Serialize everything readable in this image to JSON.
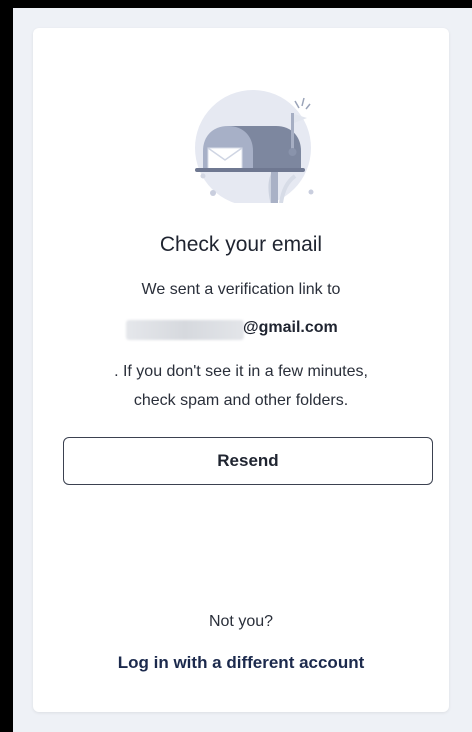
{
  "verify": {
    "title": "Check your email",
    "sent_text": "We sent a verification link to",
    "email_domain": "@gmail.com",
    "info_line1": ". If you don't see it in a few minutes,",
    "info_line2": "check spam and other folders.",
    "resend_label": "Resend",
    "not_you": "Not you?",
    "login_link": "Log in with a different account"
  },
  "icons": {
    "illustration": "mailbox-icon"
  },
  "colors": {
    "page_background": "#eef1f6",
    "card_background": "#ffffff",
    "text_dark": "#1f2430",
    "link_color": "#1c2a4d",
    "button_border": "#3b4150"
  }
}
